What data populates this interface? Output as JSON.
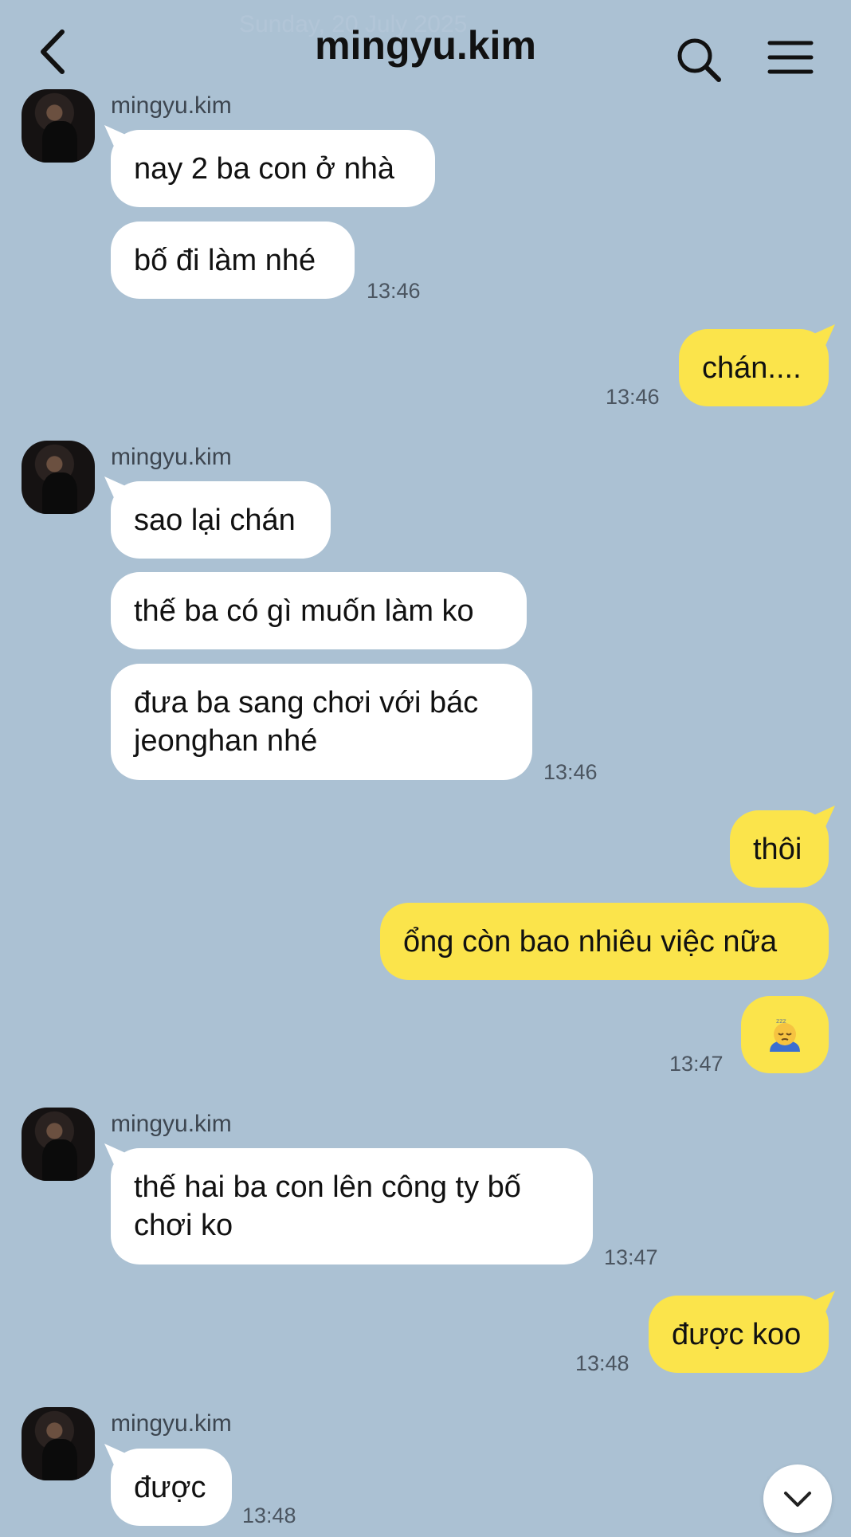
{
  "header": {
    "date_text": "Sunday, 20 July 2025",
    "title": "mingyu.kim"
  },
  "icons": {
    "back": "chevron-left-icon",
    "search": "search-icon",
    "menu": "hamburger-menu-icon",
    "scroll_down": "chevron-down-icon",
    "emoji": "sleepy-face-emoji"
  },
  "colors": {
    "background": "#abc1d3",
    "incoming_bubble": "#ffffff",
    "outgoing_bubble": "#fbe44b"
  },
  "messages": [
    {
      "sender": "mingyu.kim",
      "text": "nay 2 ba con ở nhà"
    },
    {
      "text": "bố đi làm nhé",
      "time": "13:46"
    },
    {
      "text": "chán....",
      "time": "13:46"
    },
    {
      "sender": "mingyu.kim",
      "text": "sao lại chán"
    },
    {
      "text": "thế ba có gì muốn làm ko"
    },
    {
      "text": "đưa ba sang chơi với bác jeonghan nhé",
      "time": "13:46"
    },
    {
      "text": "thôi"
    },
    {
      "text": "ổng còn bao nhiêu việc nữa"
    },
    {
      "text": "😴",
      "time": "13:47"
    },
    {
      "sender": "mingyu.kim",
      "text": "thế hai ba con lên công ty bố chơi ko",
      "time": "13:47"
    },
    {
      "text": "được koo",
      "time": "13:48"
    },
    {
      "sender": "mingyu.kim",
      "text": "được",
      "time": "13:48"
    }
  ]
}
